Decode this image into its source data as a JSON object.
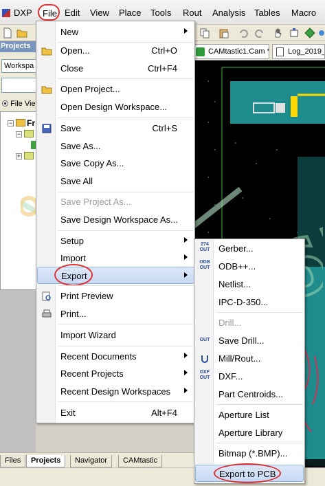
{
  "menubar": {
    "app": "DXP",
    "items": [
      "File",
      "Edit",
      "View",
      "Place",
      "Tools",
      "Rout",
      "Analysis",
      "Tables",
      "Macro"
    ]
  },
  "panel": {
    "title": "Projects",
    "workspace_combo": "Workspa",
    "file_view": "File Vie",
    "tree_root": "Fr"
  },
  "doc_tabs": [
    "CAMtastic1.Cam *",
    "Log_2019_"
  ],
  "bottom_tabs": [
    "Files",
    "Projects",
    "Navigator",
    "CAMtastic"
  ],
  "file_menu": {
    "items": [
      {
        "label": "New",
        "shortcut": "",
        "submenu": true
      },
      {
        "label": "Open...",
        "shortcut": "Ctrl+O"
      },
      {
        "label": "Close",
        "shortcut": "Ctrl+F4"
      },
      {
        "label": "Open Project..."
      },
      {
        "label": "Open Design Workspace..."
      },
      {
        "label": "Save",
        "shortcut": "Ctrl+S"
      },
      {
        "label": "Save As..."
      },
      {
        "label": "Save Copy As..."
      },
      {
        "label": "Save All"
      },
      {
        "label": "Save Project As...",
        "disabled": true
      },
      {
        "label": "Save Design Workspace As..."
      },
      {
        "label": "Setup",
        "submenu": true
      },
      {
        "label": "Import",
        "submenu": true
      },
      {
        "label": "Export",
        "submenu": true,
        "highlighted": true
      },
      {
        "label": "Print Preview"
      },
      {
        "label": "Print..."
      },
      {
        "label": "Import Wizard"
      },
      {
        "label": "Recent Documents",
        "submenu": true
      },
      {
        "label": "Recent Projects",
        "submenu": true
      },
      {
        "label": "Recent Design Workspaces",
        "submenu": true
      },
      {
        "label": "Exit",
        "shortcut": "Alt+F4"
      }
    ]
  },
  "export_menu": {
    "items": [
      {
        "label": "Gerber...",
        "icon_text": "27X OUT"
      },
      {
        "label": "ODB++...",
        "icon_text": "ODB OUT"
      },
      {
        "label": "Netlist..."
      },
      {
        "label": "IPC-D-350..."
      },
      {
        "label": "Drill...",
        "disabled": true
      },
      {
        "label": "Save Drill...",
        "icon_text": "OUT"
      },
      {
        "label": "Mill/Rout..."
      },
      {
        "label": "DXF...",
        "icon_text": "DXF OUT"
      },
      {
        "label": "Part Centroids..."
      },
      {
        "label": "Aperture List"
      },
      {
        "label": "Aperture Library"
      },
      {
        "label": "Bitmap (*.BMP)..."
      },
      {
        "label": "Export to PCB",
        "highlighted": true
      }
    ]
  },
  "watermark": "EDA365",
  "colors": {
    "highlight_border": "#e03030",
    "menu_highlight": "#c7d9f3",
    "watermark": "#9ed7b0",
    "pcb_bg": "#000000",
    "pcb_teal": "#1e8c8c",
    "pcb_green": "#3cb43c",
    "pcb_yellow": "#ffd700"
  }
}
